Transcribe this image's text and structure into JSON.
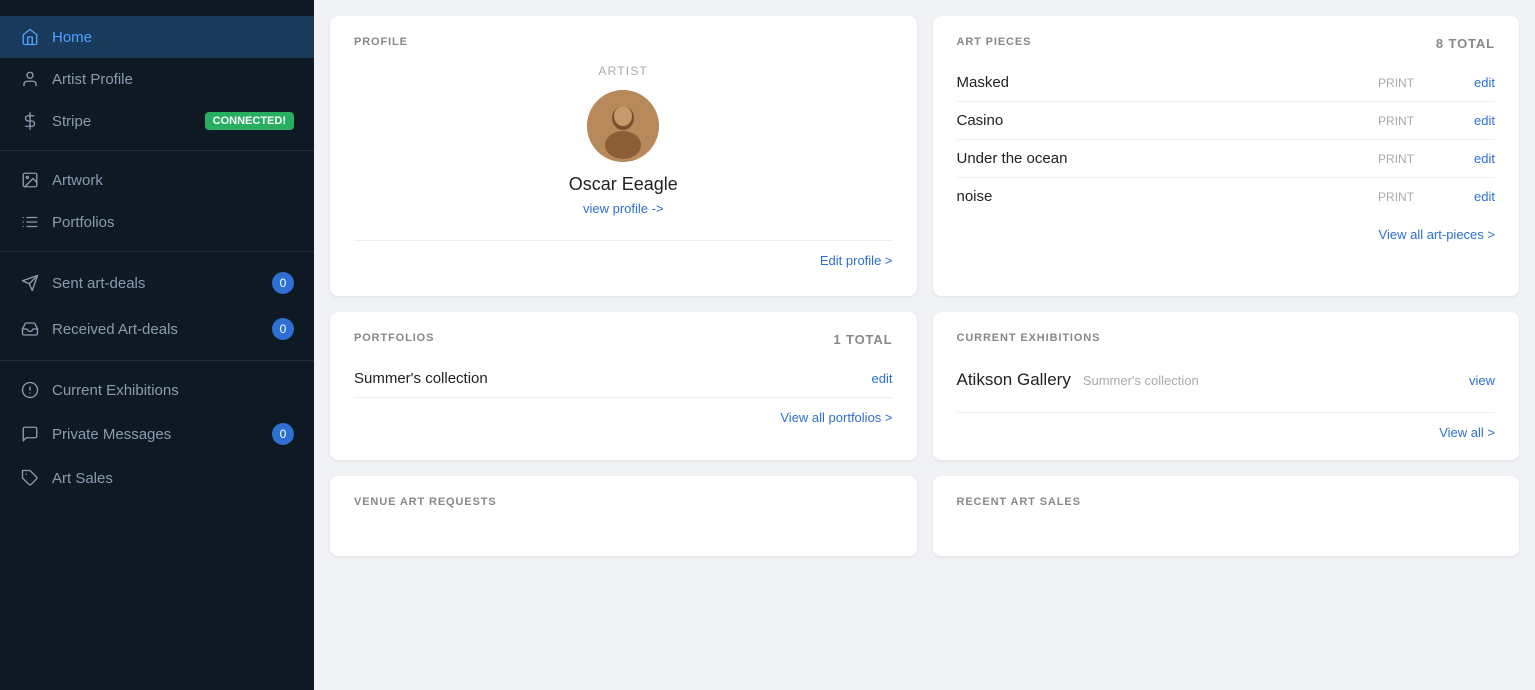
{
  "sidebar": {
    "items": [
      {
        "id": "home",
        "label": "Home",
        "icon": "home-icon",
        "active": true
      },
      {
        "id": "artist-profile",
        "label": "Artist Profile",
        "icon": "user-icon",
        "active": false
      },
      {
        "id": "stripe",
        "label": "Stripe",
        "icon": "dollar-icon",
        "active": false,
        "badge": "CONNECTED!"
      },
      {
        "id": "artwork",
        "label": "Artwork",
        "icon": "image-icon",
        "active": false
      },
      {
        "id": "portfolios",
        "label": "Portfolios",
        "icon": "list-icon",
        "active": false
      },
      {
        "id": "sent-art-deals",
        "label": "Sent art-deals",
        "icon": "send-icon",
        "active": false,
        "count": "0"
      },
      {
        "id": "received-art-deals",
        "label": "Received Art-deals",
        "icon": "inbox-icon",
        "active": false,
        "count": "0"
      },
      {
        "id": "current-exhibitions",
        "label": "Current Exhibitions",
        "icon": "circle-icon",
        "active": false
      },
      {
        "id": "private-messages",
        "label": "Private Messages",
        "icon": "message-icon",
        "active": false,
        "count": "0"
      },
      {
        "id": "art-sales",
        "label": "Art Sales",
        "icon": "tag-icon",
        "active": false
      }
    ]
  },
  "profile_card": {
    "section_title": "PROFILE",
    "artist_label": "ARTIST",
    "name": "Oscar  Eeagle",
    "view_profile": "view profile ->",
    "edit_profile": "Edit profile >"
  },
  "art_pieces_card": {
    "section_title": "ART PIECES",
    "total": "8 total",
    "items": [
      {
        "name": "Masked",
        "type": "PRINT",
        "edit": "edit"
      },
      {
        "name": "Casino",
        "type": "PRINT",
        "edit": "edit"
      },
      {
        "name": "Under the ocean",
        "type": "PRINT",
        "edit": "edit"
      },
      {
        "name": "noise",
        "type": "PRINT",
        "edit": "edit"
      }
    ],
    "view_all": "View all art-pieces >"
  },
  "portfolios_card": {
    "section_title": "PORTFOLIOS",
    "total": "1 total",
    "items": [
      {
        "name": "Summer's collection",
        "edit": "edit"
      }
    ],
    "view_all": "View all portfolios >"
  },
  "exhibitions_card": {
    "section_title": "CURRENT EXHIBITIONS",
    "items": [
      {
        "gallery": "Atikson Gallery",
        "collection": "Summer's collection",
        "view": "view"
      }
    ],
    "view_all": "View all >"
  },
  "venue_requests_card": {
    "section_title": "VENUE ART REQUESTS"
  },
  "recent_sales_card": {
    "section_title": "RECENT ART SALES"
  }
}
